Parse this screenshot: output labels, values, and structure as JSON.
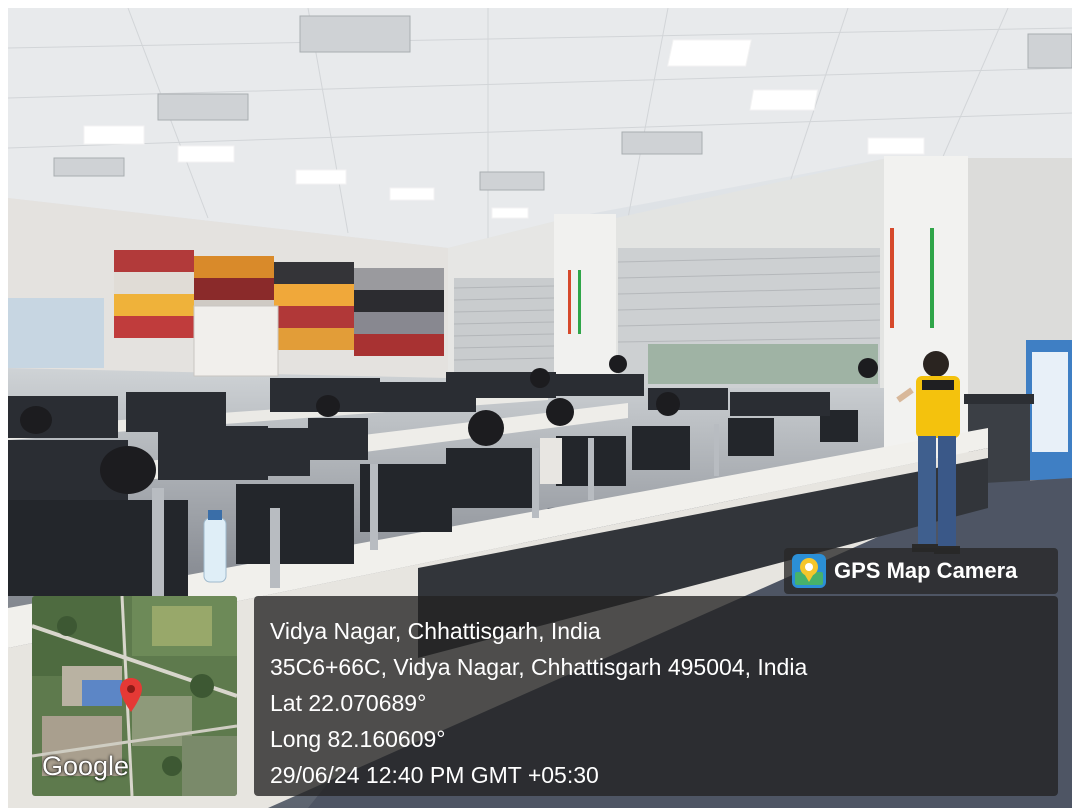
{
  "overlay": {
    "app_name": "GPS Map Camera",
    "app_icon": "map-pin-icon",
    "location_title": "Vidya Nagar, Chhattisgarh, India",
    "address": "35C6+66C, Vidya Nagar, Chhattisgarh 495004, India",
    "latitude": "Lat 22.070689°",
    "longitude": "Long 82.160609°",
    "datetime": "29/06/24 12:40 PM GMT +05:30",
    "map_provider": "Google"
  },
  "colors": {
    "overlay_bg": "#232323",
    "pin_red": "#e53935",
    "speaker_shirt": "#f4c20d"
  }
}
